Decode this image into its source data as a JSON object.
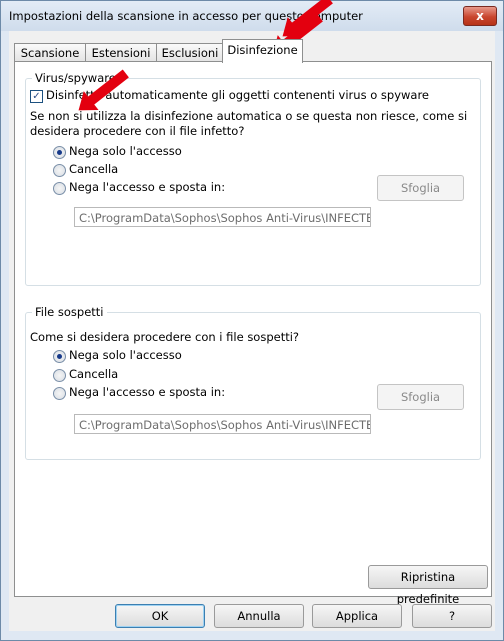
{
  "window": {
    "title": "Impostazioni della scansione in accesso per questo computer",
    "close_glyph": "x"
  },
  "tabs": [
    {
      "label": "Scansione"
    },
    {
      "label": "Estensioni"
    },
    {
      "label": "Esclusioni"
    },
    {
      "label": "Disinfezione"
    }
  ],
  "virus": {
    "legend": "Virus/spyware",
    "auto_clean_label": "Disinfetta automaticamente gli oggetti contenenti virus o spyware",
    "question_line1": "Se non si utilizza la disinfezione automatica o se questa non riesce, come si",
    "question_line2": "desidera procedere con il file infetto?",
    "options": [
      {
        "label": "Nega solo l'accesso"
      },
      {
        "label": "Cancella"
      },
      {
        "label": "Nega l'accesso e sposta in:"
      }
    ],
    "browse_label": "Sfoglia",
    "path_value": "C:\\ProgramData\\Sophos\\Sophos Anti-Virus\\INFECTED"
  },
  "suspicious": {
    "legend": "File sospetti",
    "question": "Come si desidera procedere con i file sospetti?",
    "options": [
      {
        "label": "Nega solo l'accesso"
      },
      {
        "label": "Cancella"
      },
      {
        "label": "Nega l'accesso e sposta in:"
      }
    ],
    "browse_label": "Sfoglia",
    "path_value": "C:\\ProgramData\\Sophos\\Sophos Anti-Virus\\INFECTED"
  },
  "restore_defaults_label": "Ripristina predefinite",
  "buttons": {
    "ok": "OK",
    "cancel": "Annulla",
    "apply": "Applica",
    "help": "?"
  },
  "colors": {
    "annotation_arrow": "#e3000f"
  }
}
